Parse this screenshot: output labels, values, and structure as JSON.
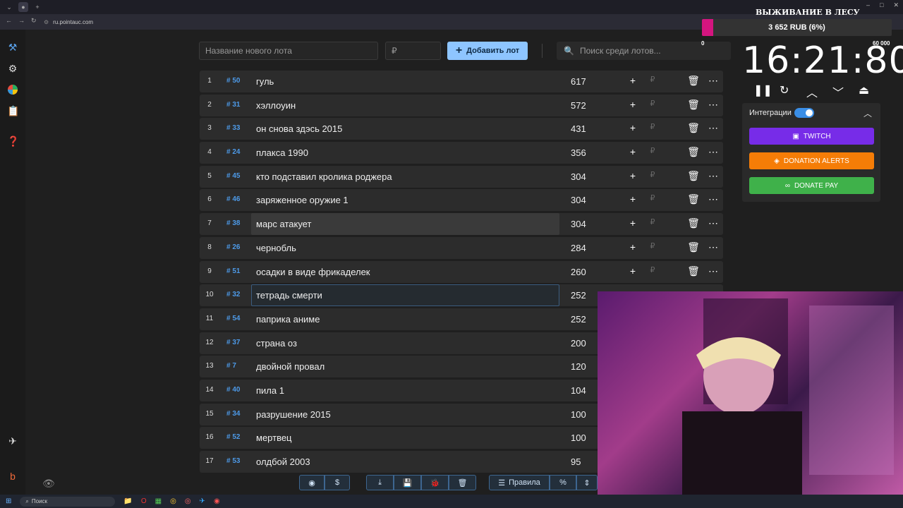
{
  "browser": {
    "url": "ru.pointauc.com",
    "window_controls": [
      "–",
      "□",
      "✕"
    ]
  },
  "sidebar": {
    "icons": [
      "auction-icon",
      "settings-icon",
      "wheel-icon",
      "clipboard-icon",
      "help-icon",
      "telegram-icon",
      "boosty-icon",
      "eye-icon"
    ]
  },
  "topbar": {
    "lot_name_placeholder": "Название нового лота",
    "amount_placeholder": "₽",
    "add_button": "Добавить лот",
    "search_placeholder": "Поиск среди лотов..."
  },
  "lots": [
    {
      "n": "1",
      "id": "# 50",
      "name": "гуль",
      "sum": "617"
    },
    {
      "n": "2",
      "id": "# 31",
      "name": "хэллоуин",
      "sum": "572"
    },
    {
      "n": "3",
      "id": "# 33",
      "name": "он снова здэсь 2015",
      "sum": "431"
    },
    {
      "n": "4",
      "id": "# 24",
      "name": "плакса 1990",
      "sum": "356"
    },
    {
      "n": "5",
      "id": "# 45",
      "name": "кто подставил кролика роджера",
      "sum": "304"
    },
    {
      "n": "6",
      "id": "# 46",
      "name": "заряженное оружие 1",
      "sum": "304"
    },
    {
      "n": "7",
      "id": "# 38",
      "name": "марс атакует",
      "sum": "304"
    },
    {
      "n": "8",
      "id": "# 26",
      "name": "чернобль",
      "sum": "284"
    },
    {
      "n": "9",
      "id": "# 51",
      "name": "осадки в виде фрикаделек",
      "sum": "260"
    },
    {
      "n": "10",
      "id": "# 32",
      "name": "тетрадь смерти",
      "sum": "252"
    },
    {
      "n": "11",
      "id": "# 54",
      "name": "паприка аниме",
      "sum": "252"
    },
    {
      "n": "12",
      "id": "# 37",
      "name": "страна оз",
      "sum": "200"
    },
    {
      "n": "13",
      "id": "# 7",
      "name": "двойной провал",
      "sum": "120"
    },
    {
      "n": "14",
      "id": "# 40",
      "name": "пила 1",
      "sum": "104"
    },
    {
      "n": "15",
      "id": "# 34",
      "name": "разрушение 2015",
      "sum": "100"
    },
    {
      "n": "16",
      "id": "# 52",
      "name": "мертвец",
      "sum": "100"
    },
    {
      "n": "17",
      "id": "# 53",
      "name": "олдбой 2003",
      "sum": "95"
    }
  ],
  "bottom_toolbar": {
    "rules_label": "Правила",
    "percent_label": "%"
  },
  "overlay": {
    "title": "ВЫЖИВАНИЕ В ЛЕСУ",
    "progress_text": "3 652 RUB (6%)",
    "progress_fraction": 0.06,
    "progress_min": "0",
    "progress_max": "60 000",
    "timer": "16:21:80"
  },
  "integrations": {
    "label": "Интеграции",
    "twitch": "TWITCH",
    "donation_alerts": "DONATION ALERTS",
    "donate_pay": "DONATE PAY",
    "colors": {
      "twitch": "#772ce8",
      "donation_alerts": "#f57d07",
      "donate_pay": "#3fb14a"
    }
  },
  "taskbar": {
    "search_label": "Поиск"
  }
}
